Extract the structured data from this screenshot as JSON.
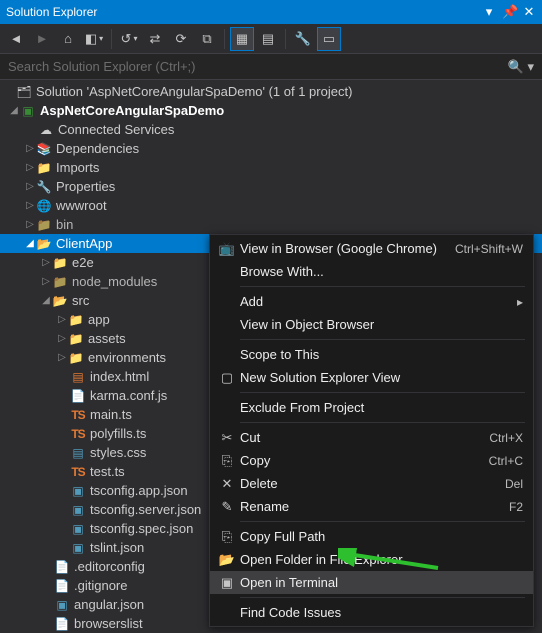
{
  "window": {
    "title": "Solution Explorer"
  },
  "search": {
    "placeholder": "Search Solution Explorer (Ctrl+;)"
  },
  "tree": {
    "solution": "Solution 'AspNetCoreAngularSpaDemo' (1 of 1 project)",
    "project": "AspNetCoreAngularSpaDemo",
    "connected_services": "Connected Services",
    "dependencies": "Dependencies",
    "imports": "Imports",
    "properties": "Properties",
    "wwwroot": "wwwroot",
    "bin": "bin",
    "clientapp": "ClientApp",
    "e2e": "e2e",
    "node_modules": "node_modules",
    "src": "src",
    "app": "app",
    "assets": "assets",
    "environments": "environments",
    "index_html": "index.html",
    "karma": "karma.conf.js",
    "main_ts": "main.ts",
    "polyfills": "polyfills.ts",
    "styles": "styles.css",
    "test_ts": "test.ts",
    "tsconfig_app": "tsconfig.app.json",
    "tsconfig_server": "tsconfig.server.json",
    "tsconfig_spec": "tsconfig.spec.json",
    "tslint": "tslint.json",
    "editorconfig": ".editorconfig",
    "gitignore": ".gitignore",
    "angular_json": "angular.json",
    "browserslist": "browserslist"
  },
  "menu": {
    "view_in_browser": "View in Browser (Google Chrome)",
    "view_in_browser_kbd": "Ctrl+Shift+W",
    "browse_with": "Browse With...",
    "add": "Add",
    "view_in_object_browser": "View in Object Browser",
    "scope": "Scope to This",
    "new_explorer": "New Solution Explorer View",
    "exclude": "Exclude From Project",
    "cut": "Cut",
    "cut_kbd": "Ctrl+X",
    "copy": "Copy",
    "copy_kbd": "Ctrl+C",
    "delete": "Delete",
    "delete_kbd": "Del",
    "rename": "Rename",
    "rename_kbd": "F2",
    "copy_full_path": "Copy Full Path",
    "open_folder": "Open Folder in File Explorer",
    "open_terminal": "Open in Terminal",
    "find_code": "Find Code Issues"
  }
}
